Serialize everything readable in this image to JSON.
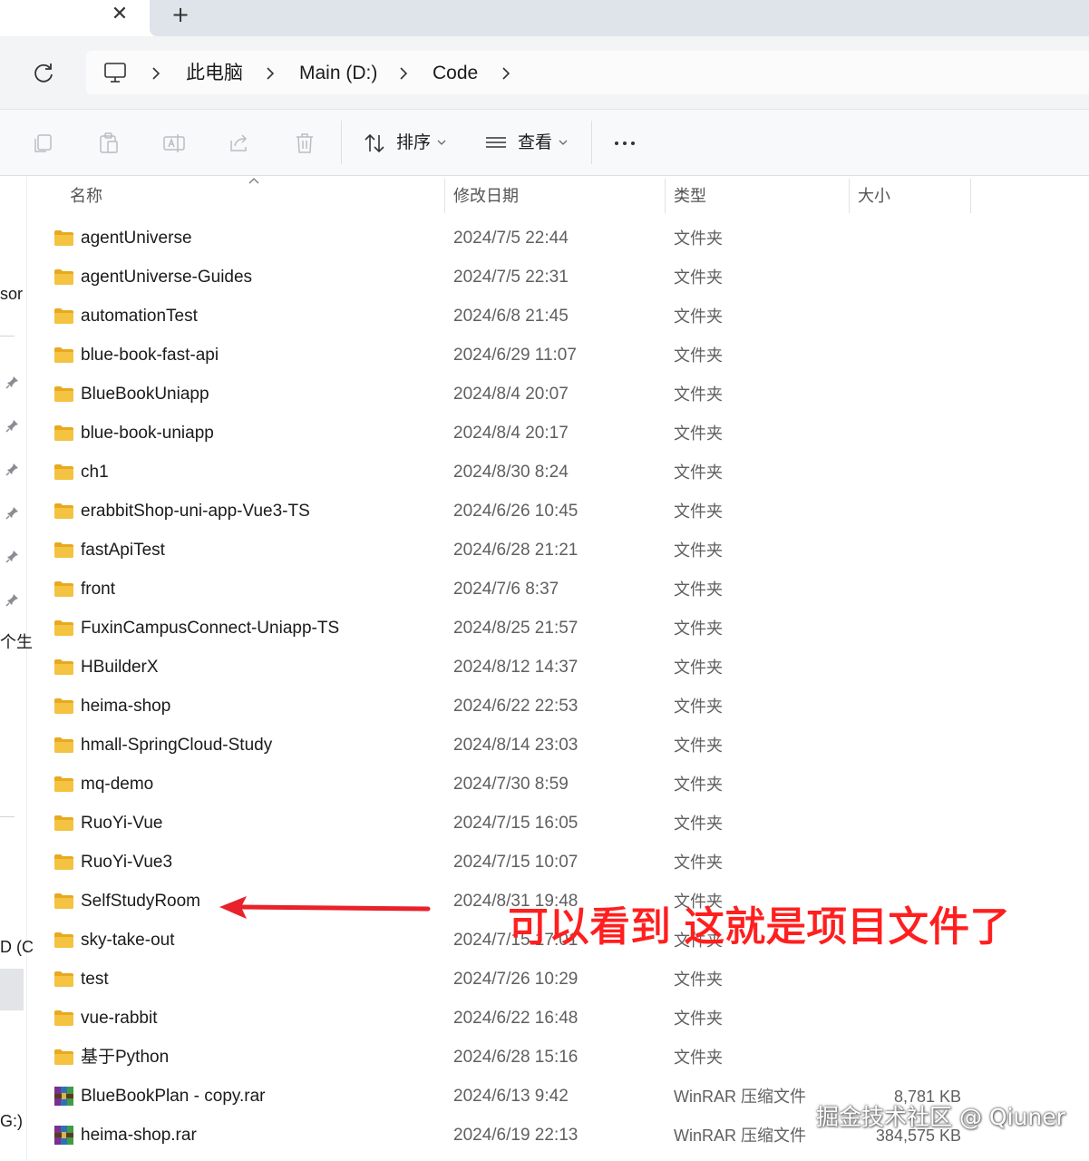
{
  "tabs": {
    "close_glyph": "✕",
    "new_tab_glyph": "+"
  },
  "address": {
    "crumbs": [
      "此电脑",
      "Main (D:)",
      "Code"
    ]
  },
  "toolbar": {
    "sort_label": "排序",
    "view_label": "查看",
    "more_glyph": "···"
  },
  "leftnav": {
    "fragments": [
      "sor",
      "个生",
      "D (C",
      "G:)"
    ]
  },
  "columns": {
    "name": "名称",
    "modified": "修改日期",
    "type": "类型",
    "size": "大小"
  },
  "files": [
    {
      "name": "agentUniverse",
      "date": "2024/7/5 22:44",
      "type": "文件夹",
      "size": "",
      "kind": "folder"
    },
    {
      "name": "agentUniverse-Guides",
      "date": "2024/7/5 22:31",
      "type": "文件夹",
      "size": "",
      "kind": "folder"
    },
    {
      "name": "automationTest",
      "date": "2024/6/8 21:45",
      "type": "文件夹",
      "size": "",
      "kind": "folder"
    },
    {
      "name": "blue-book-fast-api",
      "date": "2024/6/29 11:07",
      "type": "文件夹",
      "size": "",
      "kind": "folder"
    },
    {
      "name": "BlueBookUniapp",
      "date": "2024/8/4 20:07",
      "type": "文件夹",
      "size": "",
      "kind": "folder"
    },
    {
      "name": "blue-book-uniapp",
      "date": "2024/8/4 20:17",
      "type": "文件夹",
      "size": "",
      "kind": "folder"
    },
    {
      "name": "ch1",
      "date": "2024/8/30 8:24",
      "type": "文件夹",
      "size": "",
      "kind": "folder"
    },
    {
      "name": "erabbitShop-uni-app-Vue3-TS",
      "date": "2024/6/26 10:45",
      "type": "文件夹",
      "size": "",
      "kind": "folder"
    },
    {
      "name": "fastApiTest",
      "date": "2024/6/28 21:21",
      "type": "文件夹",
      "size": "",
      "kind": "folder"
    },
    {
      "name": "front",
      "date": "2024/7/6 8:37",
      "type": "文件夹",
      "size": "",
      "kind": "folder"
    },
    {
      "name": "FuxinCampusConnect-Uniapp-TS",
      "date": "2024/8/25 21:57",
      "type": "文件夹",
      "size": "",
      "kind": "folder"
    },
    {
      "name": "HBuilderX",
      "date": "2024/8/12 14:37",
      "type": "文件夹",
      "size": "",
      "kind": "folder"
    },
    {
      "name": "heima-shop",
      "date": "2024/6/22 22:53",
      "type": "文件夹",
      "size": "",
      "kind": "folder"
    },
    {
      "name": "hmall-SpringCloud-Study",
      "date": "2024/8/14 23:03",
      "type": "文件夹",
      "size": "",
      "kind": "folder"
    },
    {
      "name": "mq-demo",
      "date": "2024/7/30 8:59",
      "type": "文件夹",
      "size": "",
      "kind": "folder"
    },
    {
      "name": "RuoYi-Vue",
      "date": "2024/7/15 16:05",
      "type": "文件夹",
      "size": "",
      "kind": "folder"
    },
    {
      "name": "RuoYi-Vue3",
      "date": "2024/7/15 10:07",
      "type": "文件夹",
      "size": "",
      "kind": "folder"
    },
    {
      "name": "SelfStudyRoom",
      "date": "2024/8/31 19:48",
      "type": "文件夹",
      "size": "",
      "kind": "folder"
    },
    {
      "name": "sky-take-out",
      "date": "2024/7/15 17:01",
      "type": "文件夹",
      "size": "",
      "kind": "folder"
    },
    {
      "name": "test",
      "date": "2024/7/26 10:29",
      "type": "文件夹",
      "size": "",
      "kind": "folder"
    },
    {
      "name": "vue-rabbit",
      "date": "2024/6/22 16:48",
      "type": "文件夹",
      "size": "",
      "kind": "folder"
    },
    {
      "name": "基于Python",
      "date": "2024/6/28 15:16",
      "type": "文件夹",
      "size": "",
      "kind": "folder"
    },
    {
      "name": "BlueBookPlan - copy.rar",
      "date": "2024/6/13 9:42",
      "type": "WinRAR 压缩文件",
      "size": "8,781 KB",
      "kind": "rar"
    },
    {
      "name": "heima-shop.rar",
      "date": "2024/6/19 22:13",
      "type": "WinRAR 压缩文件",
      "size": "384,575 KB",
      "kind": "rar"
    }
  ],
  "annotation": {
    "text": "可以看到 这就是项目文件了",
    "color": "#ff1f1f"
  },
  "watermark": "掘金技术社区 @ Qiuner",
  "colors": {
    "folder": "#f5c342",
    "folder_dark": "#e8a91e",
    "accent": "#ff1f1f"
  }
}
